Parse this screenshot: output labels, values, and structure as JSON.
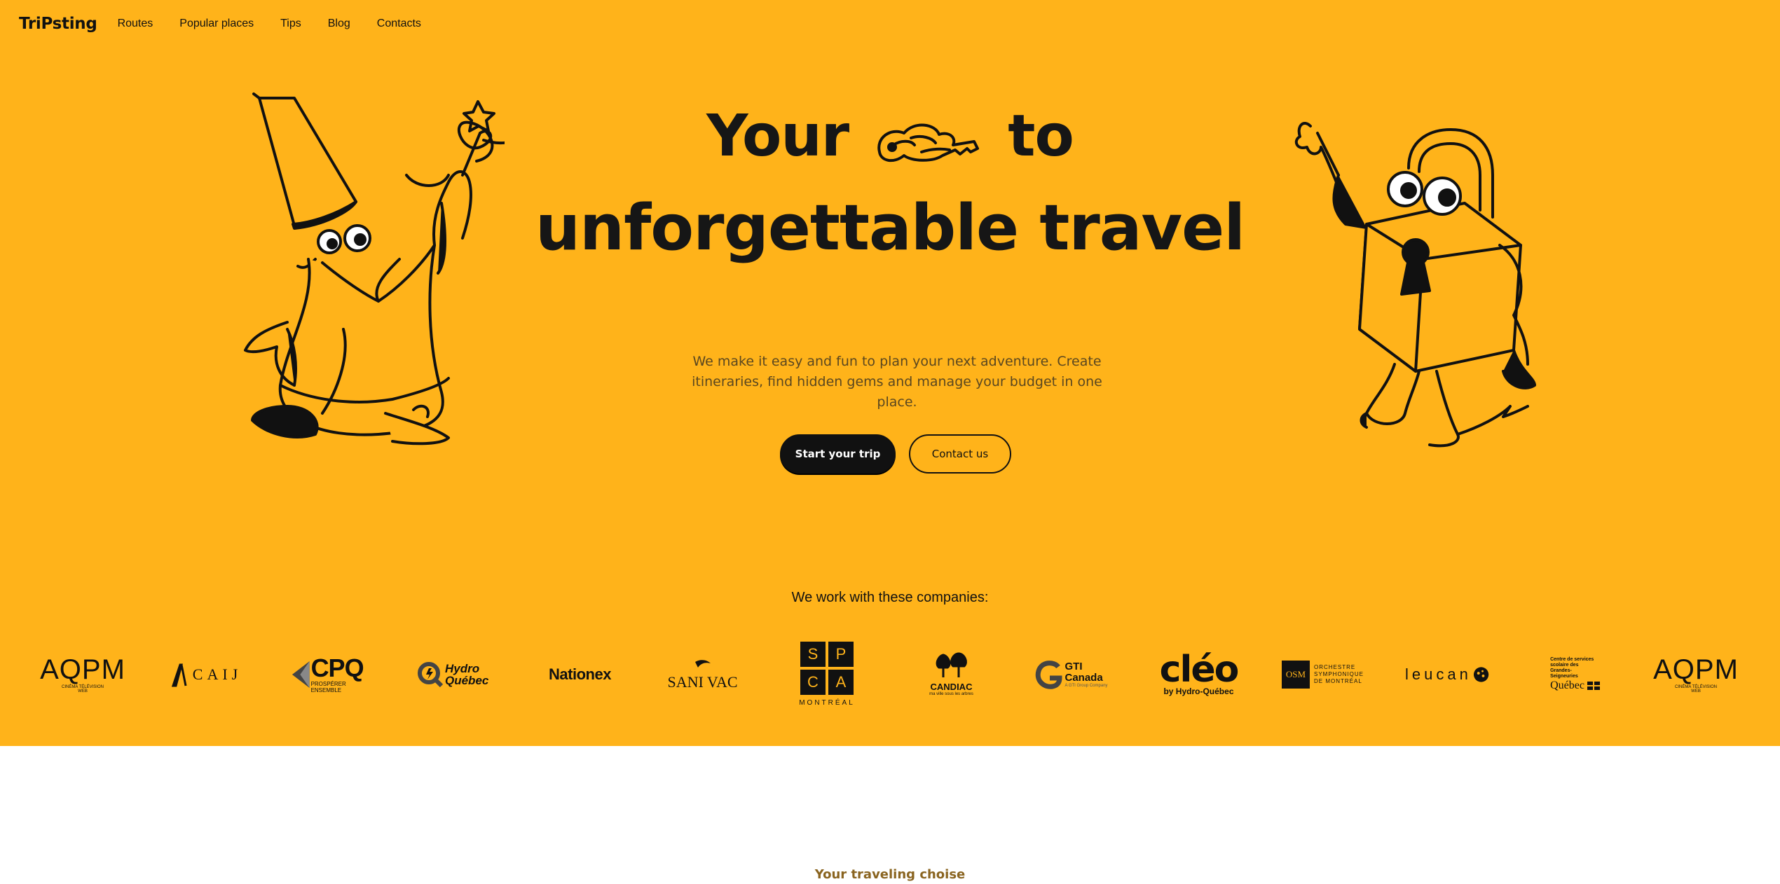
{
  "nav": {
    "brand": "TriPsting",
    "links": [
      "Routes",
      "Popular places",
      "Tips",
      "Blog",
      "Contacts"
    ]
  },
  "hero": {
    "headline_part1": "Your",
    "headline_part2": "to",
    "headline_line2": "unforgettable travel",
    "subtitle": "We make it easy and fun to plan your next adventure. Create itineraries, find hidden gems and manage your budget in one place.",
    "primary_cta": "Start your trip",
    "secondary_cta": "Contact us"
  },
  "companies": {
    "title": "We work with these companies:",
    "logos": [
      {
        "name": "AQPM",
        "sub": "CINÉMA TÉLÉVISION WEB"
      },
      {
        "name": "CAIJ"
      },
      {
        "name": "CPQ",
        "sub": "PROSPÉRER ENSEMBLE"
      },
      {
        "name": "Hydro Québec"
      },
      {
        "name": "Nationex"
      },
      {
        "name": "SANI VAC"
      },
      {
        "name": "SPCA",
        "sub": "MONTRÉAL",
        "letters": [
          "S",
          "P",
          "C",
          "A"
        ]
      },
      {
        "name": "CANDIAC",
        "sub": "ma ville sous les arbres"
      },
      {
        "name": "GTI Canada",
        "sub": "A GTI Group Company"
      },
      {
        "name": "cléo",
        "sub": "by Hydro-Québec"
      },
      {
        "name": "OSM",
        "sub": "ORCHESTRE SYMPHONIQUE DE MONTRÉAL"
      },
      {
        "name": "leucan"
      },
      {
        "name": "Québec",
        "sub": "Centre de services scolaire des Grandes-Seigneuries"
      },
      {
        "name": "AQPM",
        "sub": "CINÉMA TÉLÉVISION WEB"
      }
    ]
  },
  "next_section": {
    "label": "Your traveling choise"
  },
  "colors": {
    "hero_bg": "#FFB31A",
    "text": "#111111",
    "accent_brown": "#8a6420"
  }
}
